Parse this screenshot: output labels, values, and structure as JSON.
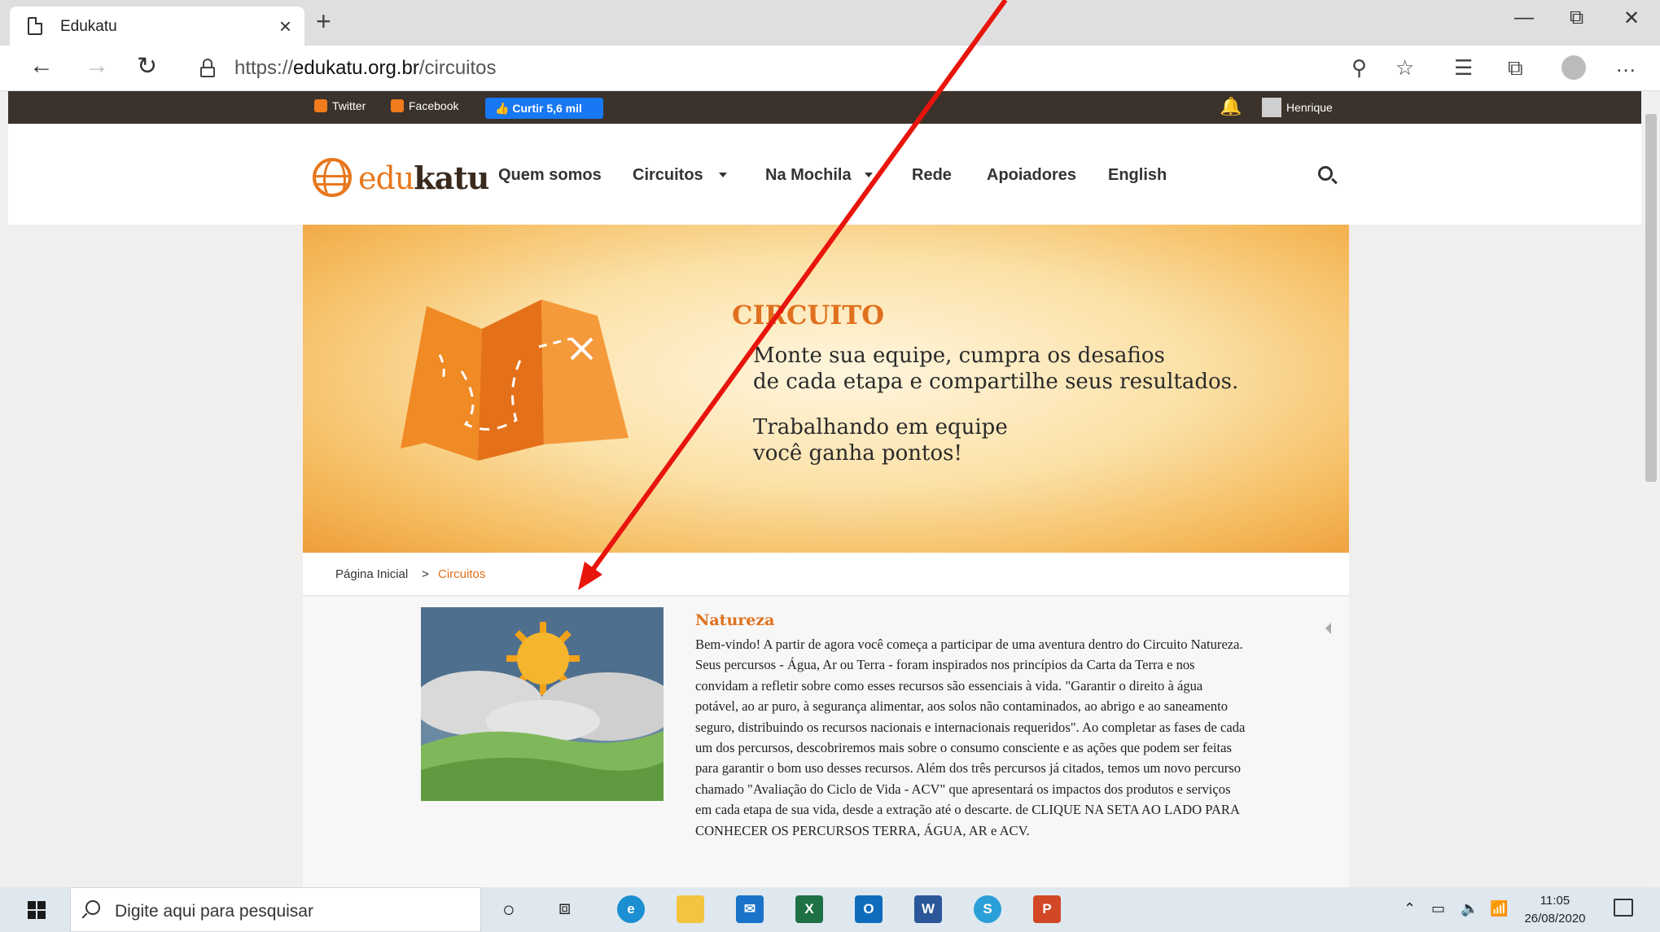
{
  "browser": {
    "tab_title": "Edukatu",
    "tab_close": "×",
    "new_tab": "+",
    "window_minimize": "—",
    "window_restore": "⧉",
    "window_close": "✕",
    "url_prefix": "https://",
    "url_domain": "edukatu.org.br",
    "url_path": "/circuitos"
  },
  "social_bar": {
    "twitter": "Twitter",
    "facebook": "Facebook",
    "like_button": "Curtir 5,6 mil",
    "user_name": "Henrique"
  },
  "site_header": {
    "logo_part1": "edu",
    "logo_part2": "katu",
    "menu": [
      "Quem somos",
      "Circuitos",
      "Na Mochila",
      "Rede",
      "Apoiadores",
      "English"
    ]
  },
  "banner": {
    "title": "CIRCUITO",
    "line1": "Monte sua equipe, cumpra os desafios",
    "line2": "de cada etapa e compartilhe seus resultados.",
    "line3": "Trabalhando em equipe",
    "line4": "você ganha pontos!"
  },
  "breadcrumb": {
    "home": "Página Inicial",
    "separator": ">",
    "current": "Circuitos"
  },
  "circuit": {
    "title": "Natureza",
    "text": "Bem-vindo! A partir de agora você começa a participar de uma aventura dentro do Circuito Natureza. Seus percursos - Água, Ar ou Terra - foram inspirados nos princípios da Carta da Terra e nos convidam a refletir sobre como esses recursos são essenciais à vida. \"Garantir o direito à água potável, ao ar puro, à segurança alimentar, aos solos não contaminados, ao abrigo e ao saneamento seguro, distribuindo os recursos nacionais e internacionais requeridos\". Ao completar as fases de cada um dos percursos, descobriremos mais sobre o consumo consciente e as ações que podem ser feitas para garantir o bom uso desses recursos. Além dos três percursos já citados, temos um novo percurso chamado \"Avaliação do Ciclo de Vida - ACV\" que apresentará os impactos dos produtos e serviços em cada etapa de sua vida, desde a extração até o descarte. de CLIQUE NA SETA AO LADO PARA CONHECER OS PERCURSOS TERRA, ÁGUA, AR e ACV."
  },
  "taskbar": {
    "search_placeholder": "Digite aqui para pesquisar",
    "time": "11:05",
    "date": "26/08/2020"
  },
  "colors": {
    "accent_orange": "#e0701d",
    "annotation_red": "#e8150c",
    "facebook_blue": "#1877f2"
  }
}
